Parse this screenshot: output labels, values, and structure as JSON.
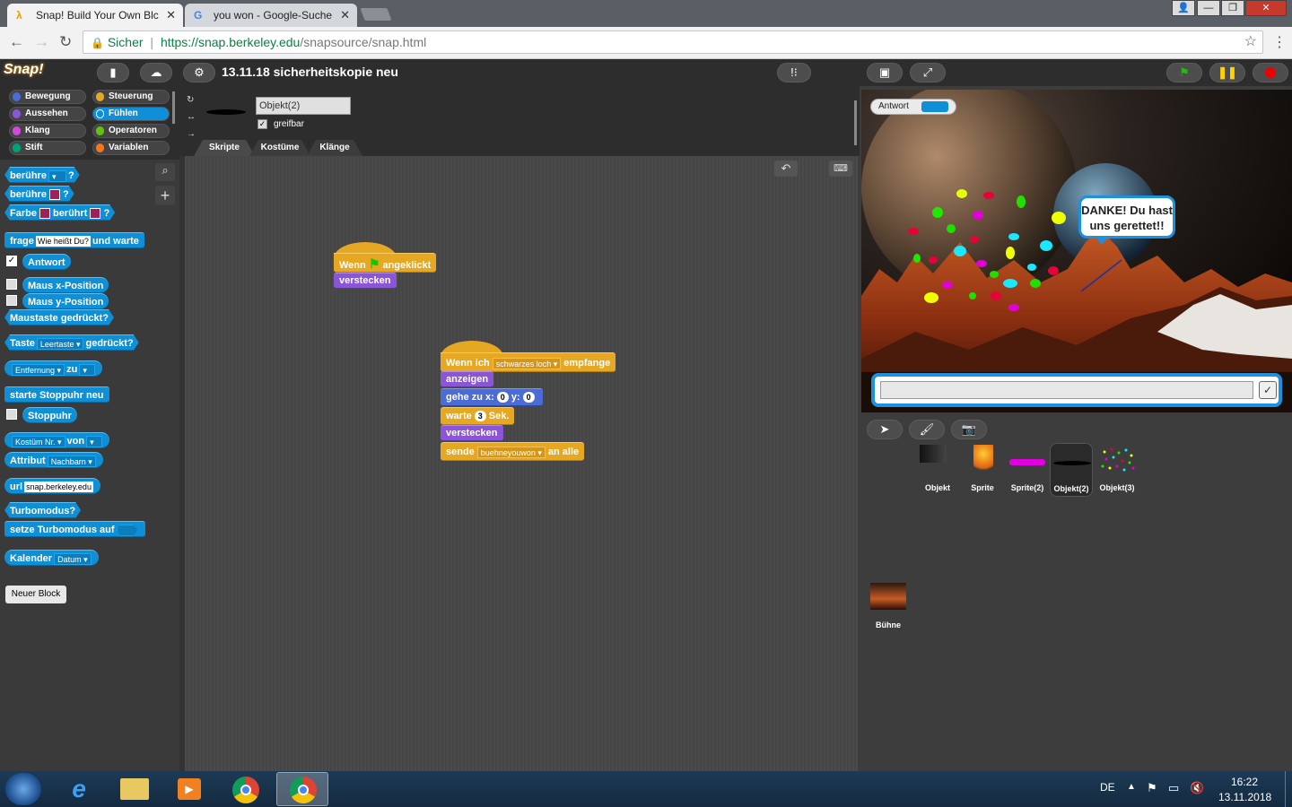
{
  "browser": {
    "tabs": [
      {
        "title": "Snap! Build Your Own Bl​c",
        "active": true
      },
      {
        "title": "you won - Google-Suche",
        "active": false
      }
    ],
    "secure_label": "Sicher",
    "url_host": "https://snap.berkeley.edu",
    "url_path": "/snapsource/snap.html"
  },
  "snap": {
    "logo": "Snap!",
    "project_title": "13.11.18 sicherheitskopie neu",
    "categories": {
      "bewegung": "Bewegung",
      "steuerung": "Steuerung",
      "aussehen": "Aussehen",
      "fuehlen": "Fühlen",
      "klang": "Klang",
      "operatoren": "Operatoren",
      "stift": "Stift",
      "variablen": "Variablen"
    },
    "category_colors": {
      "bewegung": "#4a6cd4",
      "aussehen": "#8a55d7",
      "klang": "#cf4ad9",
      "stift": "#00a178",
      "steuerung": "#e6a822",
      "fuehlen": "#0e8fd6",
      "operatoren": "#62c213",
      "variablen": "#f3761d"
    },
    "palette": {
      "beruehre1": "berühre",
      "q": "?",
      "beruehre2": "berühre",
      "farbe": "Farbe",
      "beruehrt": "berührt",
      "frage": "frage",
      "frage_default": "Wie heißt Du?",
      "und_warte": "und warte",
      "antwort": "Antwort",
      "maus_x": "Maus x-Position",
      "maus_y": "Maus y-Position",
      "maustaste": "Maustaste gedrückt?",
      "taste": "Taste",
      "leertaste": "Leertaste",
      "gedrueckt": "gedrückt?",
      "entfernung": "Entfernung",
      "zu": "zu",
      "starte_stoppuhr": "starte Stoppuhr neu",
      "stoppuhr": "Stoppuhr",
      "kostuem_nr": "Kostüm Nr.",
      "von": "von",
      "attribut": "Attribut",
      "nachbarn": "Nachbarn",
      "url": "url",
      "url_default": "snap.berkeley.edu",
      "turbomodus": "Turbomodus?",
      "setze_turbo": "setze Turbomodus auf",
      "kalender": "Kalender",
      "datum": "Datum",
      "neuer_block": "Neuer Block"
    },
    "sprite": {
      "name": "Objekt(2)",
      "draggable_label": "greifbar",
      "tabs": [
        "Skripte",
        "Kostüme",
        "Klänge"
      ]
    },
    "scripts": {
      "s1": {
        "hat_wenn": "Wenn",
        "hat_angeklickt": "angeklickt",
        "verstecken": "verstecken"
      },
      "s2": {
        "wenn_ich": "Wenn ich",
        "message": "schwarzes loch",
        "empfange": "empfange",
        "anzeigen": "anzeigen",
        "gehe_zu_x": "gehe zu x:",
        "x": "0",
        "y_label": "y:",
        "y": "0",
        "warte": "warte",
        "secs": "3",
        "sek": "Sek.",
        "verstecken": "verstecken",
        "sende": "sende",
        "send_msg": "buehneyouwon",
        "an_alle": "an alle"
      }
    },
    "stage": {
      "watcher_label": "Antwort",
      "bubble_text": "DANKE! Du hast uns gerettet!!",
      "check": "✓"
    },
    "corral_sprites": [
      "Objekt",
      "Sprite",
      "Sprite(2)",
      "Objekt(2)",
      "Objekt(3)"
    ],
    "stage_name": "Bühne"
  },
  "taskbar": {
    "lang": "DE",
    "time": "16:22",
    "date": "13.11.2018"
  }
}
